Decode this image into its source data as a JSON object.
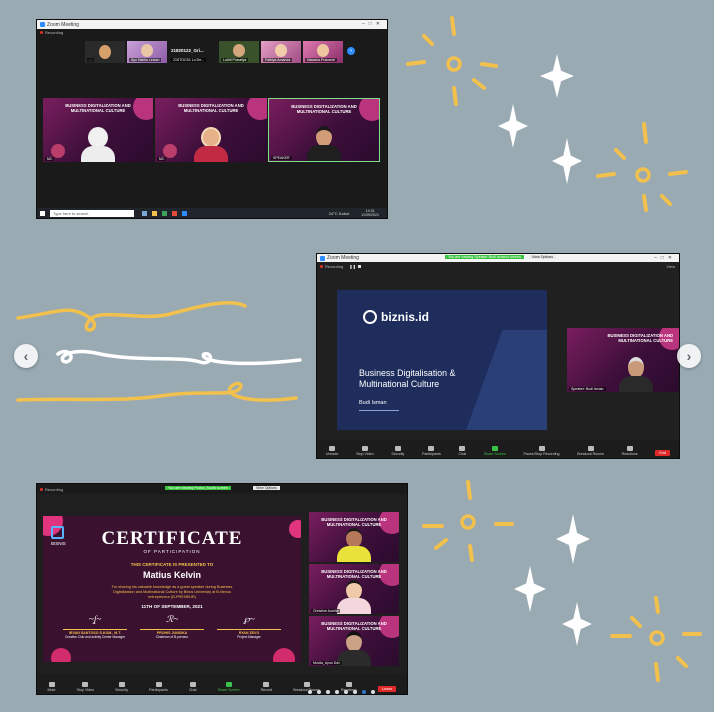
{
  "carousel": {
    "slide_count": 8,
    "active_index": 6
  },
  "colors": {
    "background": "#9aaab3",
    "sparkle_gold": "#f2c04c",
    "swirl_gold": "#f2c04c"
  },
  "win1": {
    "title": "Zoom Meeting",
    "recording": "Recording",
    "thumbs": [
      {
        "name": "...",
        "label": ""
      },
      {
        "name": "Ayu Nabila Lestari",
        "label": ""
      },
      {
        "name": "21STOCS1 Lu De...",
        "label": "21820122_Gri..."
      },
      {
        "name": "Luthfi Prasetya",
        "label": ""
      },
      {
        "name": "Fathiya Amanda",
        "label": ""
      },
      {
        "name": "Natasha Pramesti",
        "label": ""
      }
    ],
    "tiles": [
      {
        "title": "BUSINESS DIGITALIZATION AND MULTINATIONAL CULTURE",
        "name": "MC",
        "sub": "Zahra Aulia"
      },
      {
        "title": "BUSINESS DIGITALIZATION AND MULTINATIONAL CULTURE",
        "name": "MC",
        "sub": "Nadia Putri"
      },
      {
        "title": "BUSINESS DIGITALIZATION AND MULTINATIONAL CULTURE",
        "name": "SPEAKER",
        "sub": "Matius Kelvin"
      }
    ],
    "taskbar": {
      "search": "Type here to search",
      "weather": "24°C  Kabut",
      "time": "14:31",
      "date": "11/09/2021"
    }
  },
  "win2": {
    "title": "Zoom Meeting",
    "recording": "Recording",
    "banner": "You are viewing Speaker Budi Isman's screen",
    "view_options": "View Options",
    "view_label": "View",
    "slide": {
      "brand": "biznis.id",
      "title_line1": "Business Digitalisation &",
      "title_line2": "Multinational Culture",
      "presenter": "Budi Isman"
    },
    "speaker_tile": {
      "title": "BUSINESS DIGITALIZATION AND MULTINATIONAL CULTURE",
      "name": "Speaker: Budi Isman"
    },
    "toolbar": [
      "Unmute",
      "Stop Video",
      "Security",
      "Participants",
      "Chat",
      "Share Screen",
      "Pause/Stop Recording",
      "Breakout Rooms",
      "Reactions"
    ],
    "end": "End"
  },
  "win3": {
    "recording": "Recording",
    "banner": "You are viewing Pocha_Soul's screen",
    "view_options": "View Options",
    "cert": {
      "logo": "BISNIS",
      "heading": "CERTIFICATE",
      "sub": "OF PARTICIPATION",
      "presented": "THIS CERTIFICATE IS PRESENTED TO",
      "recipient": "Matius Kelvin",
      "desc_line1": "For sharing his valuable knowledge as a guest speaker during Business",
      "desc_line2": "Digitalization and Multinational Culture by Binus University at B-Nexus",
      "desc_line3": "entrepreneur (B-PRENEUR)",
      "date": "11TH OF SEPTEMBER, 2021",
      "signers": [
        {
          "name": "IRVAN SANTOSO S.KOM., M.T.",
          "role": "Creative Club and activity Center Manager"
        },
        {
          "name": "PROHIS JUNSIKA",
          "role": "Chairman of B-preneur"
        },
        {
          "name": "RYAN ZEVO",
          "role": "Project Manager"
        }
      ]
    },
    "tiles": [
      {
        "title": "BUSINESS DIGITALIZATION AND MULTINATIONAL CULTURE",
        "name": ""
      },
      {
        "title": "BUSINESS DIGITALIZATION AND MULTINATIONAL CULTURE",
        "name": "Christine Aurelia"
      },
      {
        "title": "BUSINESS DIGITALIZATION AND MULTINATIONAL CULTURE",
        "name": "Novita_Ayun Dwi"
      }
    ],
    "toolbar": [
      "Mute",
      "Stop Video",
      "Security",
      "Participants",
      "Chat",
      "Share Screen",
      "Record",
      "Breakout Rooms",
      "Reactions"
    ],
    "end": "Leave"
  }
}
